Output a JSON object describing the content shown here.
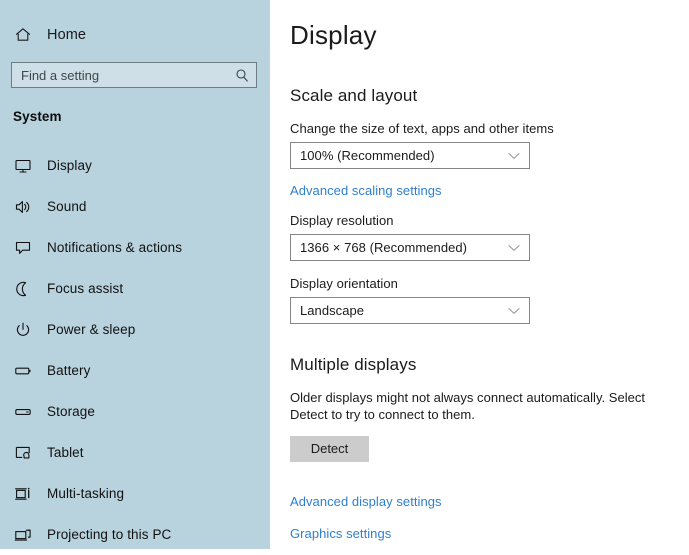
{
  "sidebar": {
    "home": {
      "label": "Home",
      "icon": "home-icon"
    },
    "search": {
      "placeholder": "Find a setting",
      "value": "",
      "icon": "search-icon"
    },
    "section_label": "System",
    "items": [
      {
        "label": "Display",
        "icon": "monitor-icon"
      },
      {
        "label": "Sound",
        "icon": "speaker-icon"
      },
      {
        "label": "Notifications & actions",
        "icon": "notification-bubble-icon"
      },
      {
        "label": "Focus assist",
        "icon": "moon-icon"
      },
      {
        "label": "Power & sleep",
        "icon": "power-icon"
      },
      {
        "label": "Battery",
        "icon": "battery-icon"
      },
      {
        "label": "Storage",
        "icon": "storage-drive-icon"
      },
      {
        "label": "Tablet",
        "icon": "tablet-touch-icon"
      },
      {
        "label": "Multi-tasking",
        "icon": "task-view-icon"
      },
      {
        "label": "Projecting to this PC",
        "icon": "projecting-screens-icon"
      }
    ]
  },
  "main": {
    "title": "Display",
    "scale_and_layout": {
      "heading": "Scale and layout",
      "scale_label": "Change the size of text, apps and other items",
      "scale_value": "100% (Recommended)",
      "advanced_scaling_link": "Advanced scaling settings",
      "resolution_label": "Display resolution",
      "resolution_value": "1366 × 768 (Recommended)",
      "orientation_label": "Display orientation",
      "orientation_value": "Landscape"
    },
    "multiple_displays": {
      "heading": "Multiple displays",
      "description": "Older displays might not always connect automatically. Select Detect to try to connect to them.",
      "detect_button": "Detect",
      "advanced_display_link": "Advanced display settings",
      "graphics_link": "Graphics settings"
    }
  },
  "colors": {
    "sidebar_bg": "#b8d2de",
    "link_blue": "#2f7fd0",
    "button_gray": "#cccccc",
    "text": "#1b1b1b"
  }
}
